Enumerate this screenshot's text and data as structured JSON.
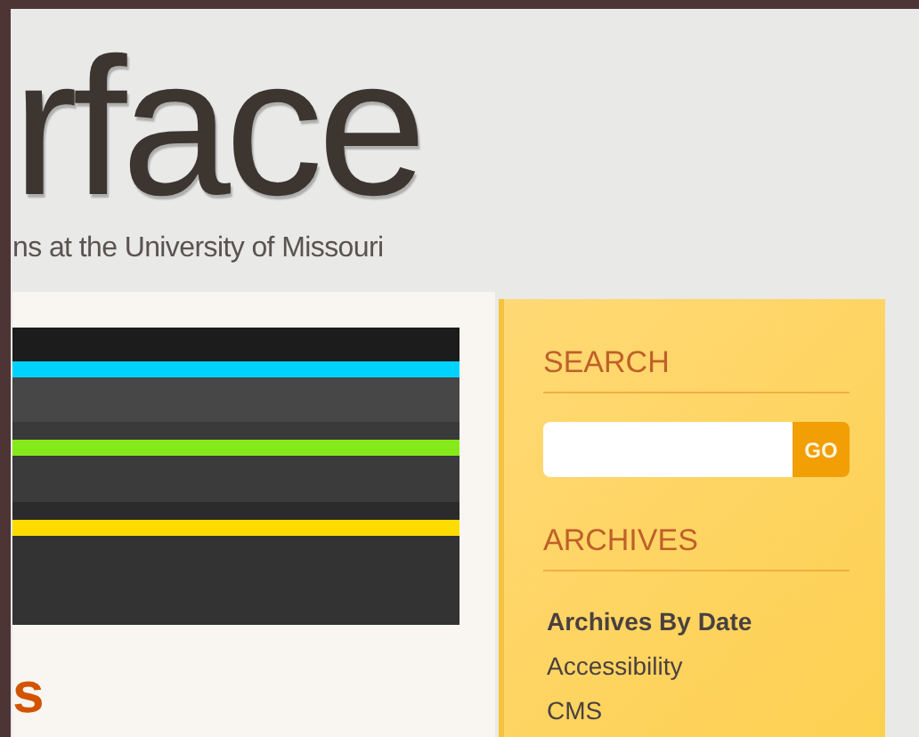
{
  "header": {
    "title": "rface",
    "subtitle": "ns at the University of Missouri"
  },
  "main": {
    "heading": "s"
  },
  "sidebar": {
    "search": {
      "heading": "SEARCH",
      "button": "GO"
    },
    "archives": {
      "heading": "ARCHIVES",
      "items": [
        {
          "label": "Archives By Date",
          "kind": "heading"
        },
        {
          "label": "Accessibility",
          "kind": "link"
        },
        {
          "label": "CMS",
          "kind": "link"
        }
      ]
    }
  }
}
